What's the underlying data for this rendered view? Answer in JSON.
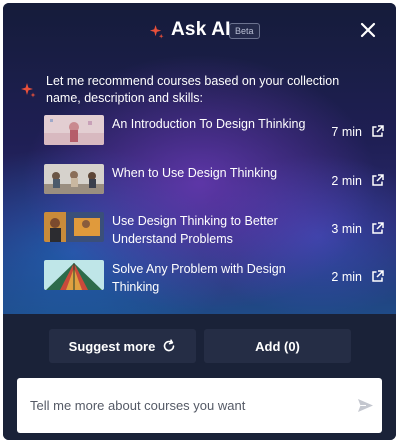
{
  "header": {
    "title": "Ask AI",
    "badge": "Beta",
    "sparkle_icon": "sparkle-icon",
    "close_icon": "close-icon"
  },
  "intro": {
    "text": "Let me recommend courses based on your collection name, description and skills:"
  },
  "courses": [
    {
      "title": "An Introduction To Design Thinking",
      "duration": "7 min",
      "open_icon": "external-link-icon"
    },
    {
      "title": "When to Use Design Thinking",
      "duration": "2 min",
      "open_icon": "external-link-icon"
    },
    {
      "title": "Use Design Thinking to Better Understand Problems",
      "duration": "3 min",
      "open_icon": "external-link-icon"
    },
    {
      "title": "Solve Any Problem with Design Thinking",
      "duration": "2 min",
      "open_icon": "external-link-icon"
    }
  ],
  "actions": {
    "suggest_more_label": "Suggest more",
    "suggest_icon": "refresh-icon",
    "add_label": "Add (0)"
  },
  "prompt": {
    "placeholder": "Tell me more about courses you want",
    "value": "",
    "send_icon": "send-icon"
  },
  "colors": {
    "accent_sparkle": "#e8503a",
    "panel_bg": "#1a2238",
    "button_bg": "#252d45"
  }
}
